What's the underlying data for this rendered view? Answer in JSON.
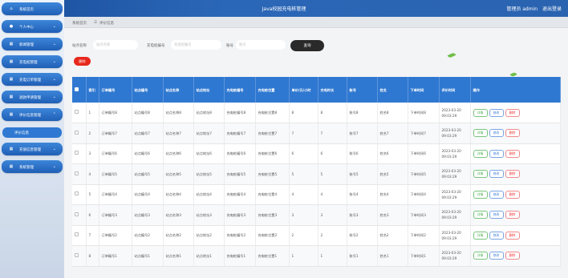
{
  "header": {
    "title": "Java校园充电桩管理",
    "admin_label": "管理员 admin",
    "logout_label": "退出登录"
  },
  "sidebar": {
    "items": [
      {
        "label": "系统首页",
        "icon": "home-icon"
      },
      {
        "label": "个人中心",
        "icon": "user-icon"
      },
      {
        "label": "新闻管理",
        "icon": "grid-icon"
      },
      {
        "label": "充电桩管理",
        "icon": "grid-icon"
      },
      {
        "label": "充电订单管理",
        "icon": "grid-icon"
      },
      {
        "label": "退款申请管理",
        "icon": "grid-icon"
      },
      {
        "label": "评价信息管理",
        "icon": "grid-icon"
      },
      {
        "label": "充值信息管理",
        "icon": "grid-icon"
      },
      {
        "label": "系统管理",
        "icon": "grid-icon"
      }
    ],
    "submenu_label": "评价信息"
  },
  "breadcrumb": {
    "home": "系统首页",
    "sep": "☰",
    "current": "评价信息"
  },
  "filters": {
    "station_label": "站点名称",
    "station_placeholder": "站点名称",
    "pile_label": "充电桩编号",
    "pile_placeholder": "充电桩编号",
    "account_label": "账号",
    "account_placeholder": "账号",
    "search_button": "查询"
  },
  "delete_button": "删除",
  "table": {
    "headers": [
      "索引",
      "订单编号",
      "站点编号",
      "站点名称",
      "站点地址",
      "充电桩编号",
      "充电桩位置",
      "单价/元/小时",
      "充电时长",
      "账号",
      "姓名",
      "下单时间",
      "评价时间",
      "操作"
    ],
    "actions": {
      "detail": "详情",
      "edit": "修改",
      "delete": "删除"
    },
    "rows": [
      [
        "1",
        "订单编号8",
        "站点编号8",
        "站点名称8",
        "站点地址8",
        "充电桩编号8",
        "充电桩位置8",
        "8",
        "8",
        "账号8",
        "姓名8",
        "下单时间8",
        "2023-03-20 09:03:29"
      ],
      [
        "2",
        "订单编号7",
        "站点编号7",
        "站点名称7",
        "站点地址7",
        "充电桩编号7",
        "充电桩位置7",
        "7",
        "7",
        "账号7",
        "姓名7",
        "下单时间7",
        "2023-03-20 09:03:29"
      ],
      [
        "3",
        "订单编号6",
        "站点编号6",
        "站点名称6",
        "站点地址6",
        "充电桩编号6",
        "充电桩位置6",
        "6",
        "6",
        "账号6",
        "姓名6",
        "下单时间6",
        "2023-03-20 09:03:29"
      ],
      [
        "4",
        "订单编号5",
        "站点编号5",
        "站点名称5",
        "站点地址5",
        "充电桩编号5",
        "充电桩位置5",
        "5",
        "5",
        "账号5",
        "姓名5",
        "下单时间5",
        "2023-03-20 09:03:29"
      ],
      [
        "5",
        "订单编号4",
        "站点编号4",
        "站点名称4",
        "站点地址4",
        "充电桩编号4",
        "充电桩位置4",
        "4",
        "4",
        "账号4",
        "姓名4",
        "下单时间4",
        "2023-03-20 09:03:29"
      ],
      [
        "6",
        "订单编号3",
        "站点编号3",
        "站点名称3",
        "站点地址3",
        "充电桩编号3",
        "充电桩位置3",
        "3",
        "3",
        "账号3",
        "姓名3",
        "下单时间3",
        "2023-03-20 09:03:29"
      ],
      [
        "7",
        "订单编号2",
        "站点编号2",
        "站点名称2",
        "站点地址2",
        "充电桩编号2",
        "充电桩位置2",
        "2",
        "2",
        "账号2",
        "姓名2",
        "下单时间2",
        "2023-03-20 09:03:29"
      ],
      [
        "8",
        "订单编号1",
        "站点编号1",
        "站点名称1",
        "站点地址1",
        "充电桩编号1",
        "充电桩位置1",
        "1",
        "1",
        "账号1",
        "姓名1",
        "下单时间1",
        "2023-03-20 09:03:29"
      ]
    ]
  },
  "colors": {
    "header_blue": "#2b67b8",
    "table_header": "#2f78d1",
    "delete_red": "#e8281c",
    "search_dark": "#2a2a2a"
  }
}
